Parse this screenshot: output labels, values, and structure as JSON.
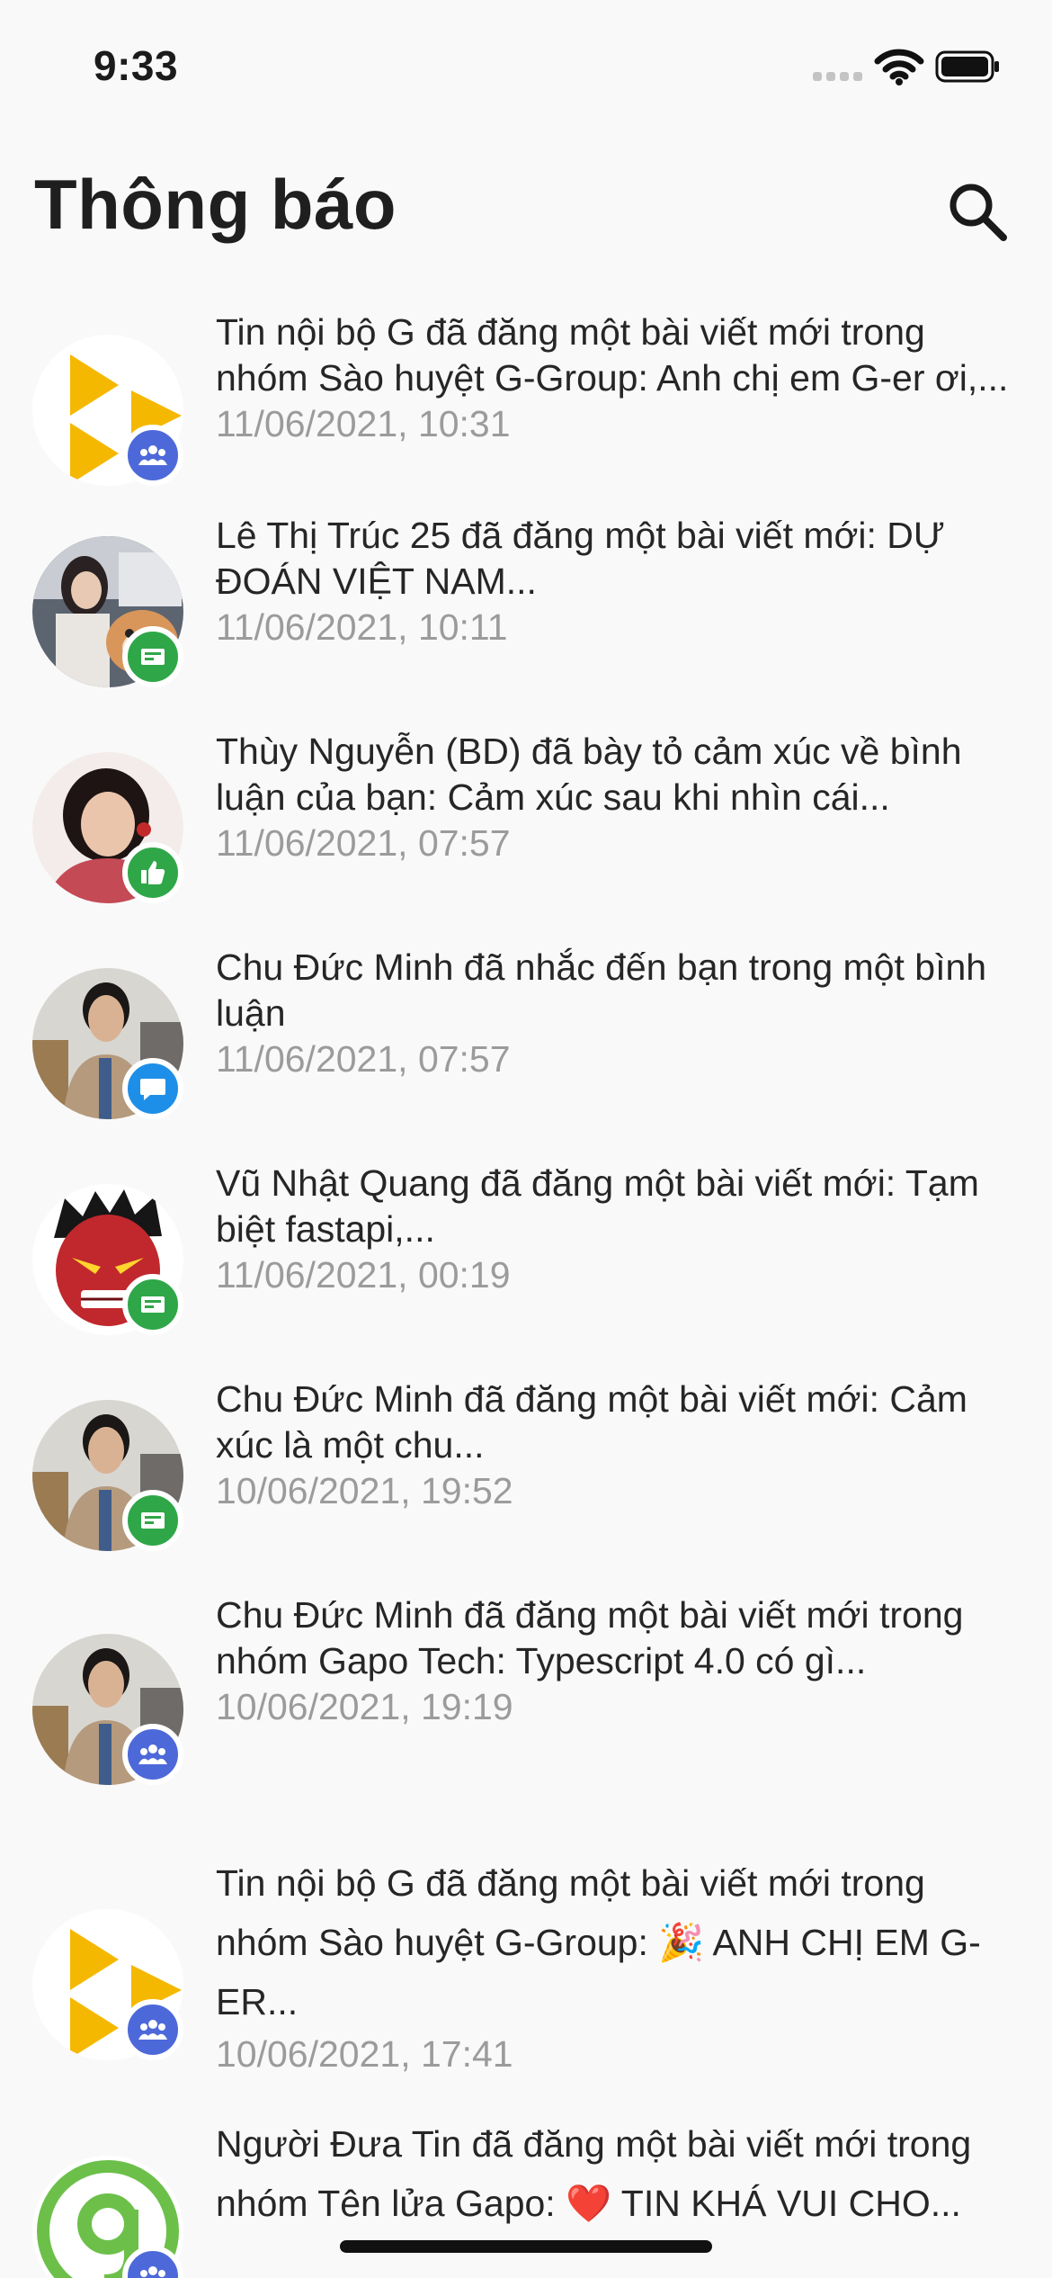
{
  "status_bar": {
    "time": "9:33"
  },
  "header": {
    "title": "Thông báo",
    "search_icon": "search-icon"
  },
  "colors": {
    "badge_group": "#4d69d9",
    "badge_post": "#2fa748",
    "badge_like": "#2fa748",
    "badge_comment": "#1e8fe8",
    "timestamp": "#9b9b9b"
  },
  "notifications": [
    {
      "message": "Tin nội bộ G đã đăng một bài viết mới trong nhóm Sào huyệt G-Group: Anh chị em G-er ơi,...",
      "time": "11/06/2021, 10:31",
      "badge": "group-icon",
      "avatar": "g-play-logo"
    },
    {
      "message": "Lê Thị Trúc 25 đã đăng một bài viết mới: DỰ ĐOÁN VIỆT NAM...",
      "time": "11/06/2021, 10:11",
      "badge": "post-icon",
      "avatar": "user-photo"
    },
    {
      "message": "Thùy Nguyễn (BD) đã bày tỏ cảm xúc về bình luận của bạn: Cảm xúc sau khi nhìn cái...",
      "time": "11/06/2021, 07:57",
      "badge": "thumbs-up-icon",
      "avatar": "user-photo"
    },
    {
      "message": "Chu Đức Minh đã nhắc đến bạn trong một bình luận",
      "time": "11/06/2021, 07:57",
      "badge": "comment-icon",
      "avatar": "user-photo"
    },
    {
      "message": "Vũ Nhật Quang đã đăng một bài viết mới: Tạm biệt fastapi,...",
      "time": "11/06/2021, 00:19",
      "badge": "post-icon",
      "avatar": "hulk-avatar"
    },
    {
      "message": "Chu Đức Minh đã đăng một bài viết mới: Cảm xúc là một chu...",
      "time": "10/06/2021, 19:52",
      "badge": "post-icon",
      "avatar": "user-photo"
    },
    {
      "message": "Chu Đức Minh đã đăng một bài viết mới trong nhóm Gapo Tech: Typescript 4.0 có gì...",
      "time": "10/06/2021, 19:19",
      "badge": "group-icon",
      "avatar": "user-photo"
    },
    {
      "message": "Tin nội bộ G đã đăng một bài viết mới trong nhóm Sào huyệt G-Group: 🎉 ANH CHỊ EM G-ER...",
      "time": "10/06/2021, 17:41",
      "badge": "group-icon",
      "avatar": "g-play-logo"
    },
    {
      "message": "Người Đưa Tin đã đăng một bài viết mới trong nhóm Tên lửa Gapo: ❤️ TIN KHÁ VUI CHO...",
      "time": "",
      "badge": "group-icon",
      "avatar": "gapo-logo"
    }
  ]
}
